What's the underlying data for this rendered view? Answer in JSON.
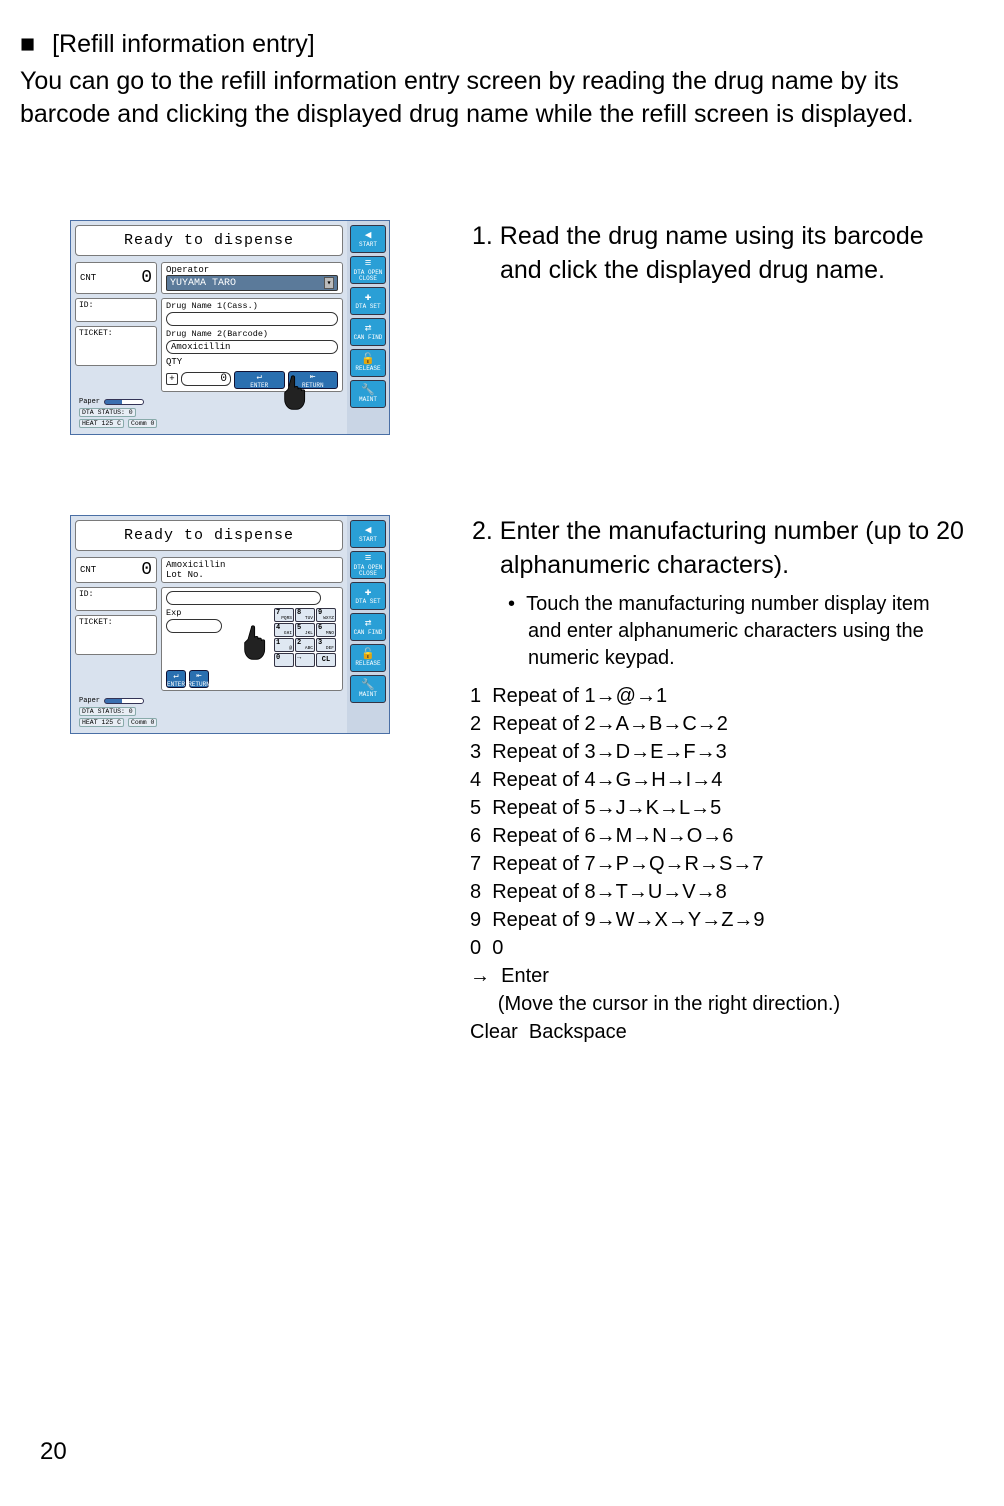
{
  "heading": "[Refill information entry]",
  "intro": "You can go to the refill information entry screen by reading the drug name by its barcode and clicking the displayed drug name while the refill screen is displayed.",
  "step1": "1. Read the drug name using its barcode and click the displayed drug name.",
  "step2": "2. Enter the manufacturing number (up to 20 alphanumeric characters).",
  "step2_sub": "Touch the manufacturing number display item and enter alphanumeric characters using the numeric keypad.",
  "keymap": [
    "1  Repeat of 1→@→1",
    "2  Repeat of 2→A→B→C→2",
    "3  Repeat of 3→D→E→F→3",
    "4  Repeat of 4→G→H→I→4",
    "5  Repeat of 5→J→K→L→5",
    "6  Repeat of 6→M→N→O→6",
    "7  Repeat of 7→P→Q→R→S→7",
    "8  Repeat of 8→T→U→V→8",
    "9  Repeat of 9→W→X→Y→Z→9",
    "0  0",
    "→  Enter",
    "     (Move the cursor in the right direction.)",
    "Clear  Backspace"
  ],
  "page_number": "20",
  "screen": {
    "title": "Ready to dispense",
    "cnt_label": "CNT",
    "cnt_value": "0",
    "id_label": "ID:",
    "ticket_label": "TICKET:",
    "operator_label": "Operator",
    "operator_value": "YUYAMA TARO",
    "drug1_label": "Drug Name 1(Cass.)",
    "drug2_label": "Drug Name 2(Barcode)",
    "drug2_value": "Amoxicillin",
    "qty_label": "QTY",
    "qty_value": "0",
    "paper_label": "Paper",
    "dta_status": "DTA STATUS:     0",
    "heat": "HEAT 125  C",
    "comm": "Comm 0",
    "enter_btn": "ENTER",
    "return_btn": "RETURN",
    "side": {
      "start": "START",
      "dta": "DTA OPEN CLOSE",
      "set": "DTA SET",
      "find": "CAN FIND",
      "release": "RELEASE",
      "maint": "MAINT"
    }
  },
  "screen2": {
    "drug_name": "Amoxicillin",
    "lot_label": "Lot No.",
    "exp_label": "Exp",
    "keypad": [
      {
        "n": "7",
        "s": "PQRS"
      },
      {
        "n": "8",
        "s": "TUV"
      },
      {
        "n": "9",
        "s": "WXYZ"
      },
      {
        "n": "4",
        "s": "GHI"
      },
      {
        "n": "5",
        "s": "JKL"
      },
      {
        "n": "6",
        "s": "MNO"
      },
      {
        "n": "1",
        "s": "@"
      },
      {
        "n": "2",
        "s": "ABC"
      },
      {
        "n": "3",
        "s": "DEF"
      },
      {
        "n": "0",
        "s": ""
      },
      {
        "n": "→",
        "s": ""
      },
      {
        "n": "CL",
        "s": ""
      }
    ]
  }
}
